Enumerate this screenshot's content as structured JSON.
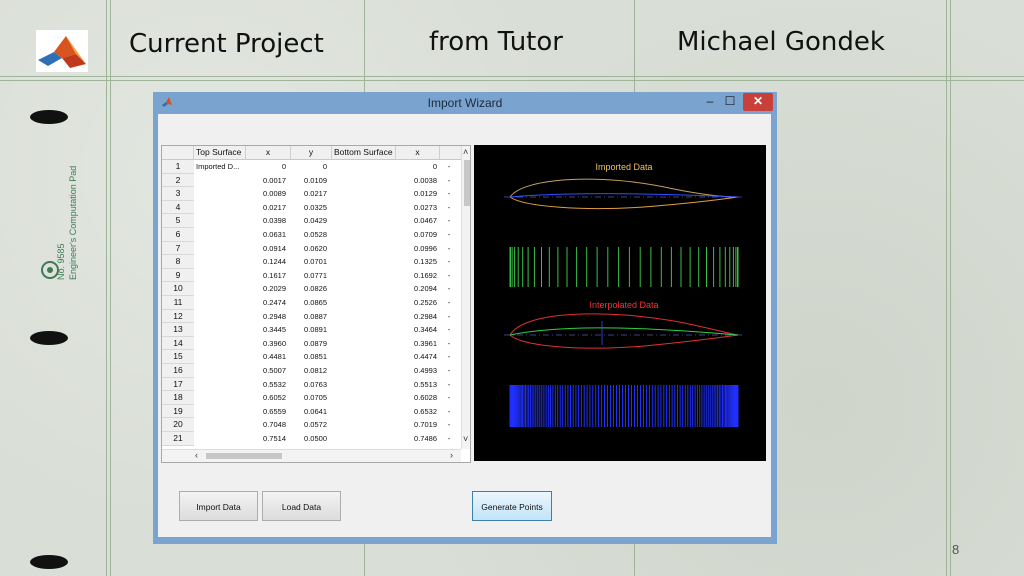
{
  "slide": {
    "title_left": "Current Project",
    "title_center": "from Tutor",
    "title_right": "Michael Gondek",
    "page_number": "8",
    "side_label_1": "No. 9585",
    "side_label_2": "Engineer's Computation Pad"
  },
  "window": {
    "title": "Import Wizard",
    "min_label": "–",
    "max_label": "☐",
    "close_label": "✕"
  },
  "table": {
    "headers": [
      "Top Surface",
      "x",
      "y",
      "Bottom Surface",
      "x"
    ],
    "rows": [
      {
        "n": "1",
        "label": "Imported D...",
        "x": "0",
        "y": "0",
        "bx": "0"
      },
      {
        "n": "2",
        "label": "",
        "x": "0.0017",
        "y": "0.0109",
        "bx": "0.0038"
      },
      {
        "n": "3",
        "label": "",
        "x": "0.0089",
        "y": "0.0217",
        "bx": "0.0129"
      },
      {
        "n": "4",
        "label": "",
        "x": "0.0217",
        "y": "0.0325",
        "bx": "0.0273"
      },
      {
        "n": "5",
        "label": "",
        "x": "0.0398",
        "y": "0.0429",
        "bx": "0.0467"
      },
      {
        "n": "6",
        "label": "",
        "x": "0.0631",
        "y": "0.0528",
        "bx": "0.0709"
      },
      {
        "n": "7",
        "label": "",
        "x": "0.0914",
        "y": "0.0620",
        "bx": "0.0996"
      },
      {
        "n": "8",
        "label": "",
        "x": "0.1244",
        "y": "0.0701",
        "bx": "0.1325"
      },
      {
        "n": "9",
        "label": "",
        "x": "0.1617",
        "y": "0.0771",
        "bx": "0.1692"
      },
      {
        "n": "10",
        "label": "",
        "x": "0.2029",
        "y": "0.0826",
        "bx": "0.2094"
      },
      {
        "n": "11",
        "label": "",
        "x": "0.2474",
        "y": "0.0865",
        "bx": "0.2526"
      },
      {
        "n": "12",
        "label": "",
        "x": "0.2948",
        "y": "0.0887",
        "bx": "0.2984"
      },
      {
        "n": "13",
        "label": "",
        "x": "0.3445",
        "y": "0.0891",
        "bx": "0.3464"
      },
      {
        "n": "14",
        "label": "",
        "x": "0.3960",
        "y": "0.0879",
        "bx": "0.3961"
      },
      {
        "n": "15",
        "label": "",
        "x": "0.4481",
        "y": "0.0851",
        "bx": "0.4474"
      },
      {
        "n": "16",
        "label": "",
        "x": "0.5007",
        "y": "0.0812",
        "bx": "0.4993"
      },
      {
        "n": "17",
        "label": "",
        "x": "0.5532",
        "y": "0.0763",
        "bx": "0.5513"
      },
      {
        "n": "18",
        "label": "",
        "x": "0.6052",
        "y": "0.0705",
        "bx": "0.6028"
      },
      {
        "n": "19",
        "label": "",
        "x": "0.6559",
        "y": "0.0641",
        "bx": "0.6532"
      },
      {
        "n": "20",
        "label": "",
        "x": "0.7048",
        "y": "0.0572",
        "bx": "0.7019"
      },
      {
        "n": "21",
        "label": "",
        "x": "0.7514",
        "y": "0.0500",
        "bx": "0.7486"
      }
    ]
  },
  "plot": {
    "imported_label": "Imported Data",
    "interpolated_label": "Interpolated Data",
    "colors": {
      "imported_label": "#f0c060",
      "interpolated_label": "#ff3030",
      "outline_upper": "#c8a060",
      "outline_lower": "#e0a040",
      "camber": "#3050ff",
      "imported_ticks": "#38c048",
      "interp_upper": "#e03030",
      "interp_camber": "#30d040",
      "interp_ticks": "#2030ff"
    }
  },
  "buttons": {
    "import": "Import Data",
    "load": "Load Data",
    "generate": "Generate Points"
  }
}
